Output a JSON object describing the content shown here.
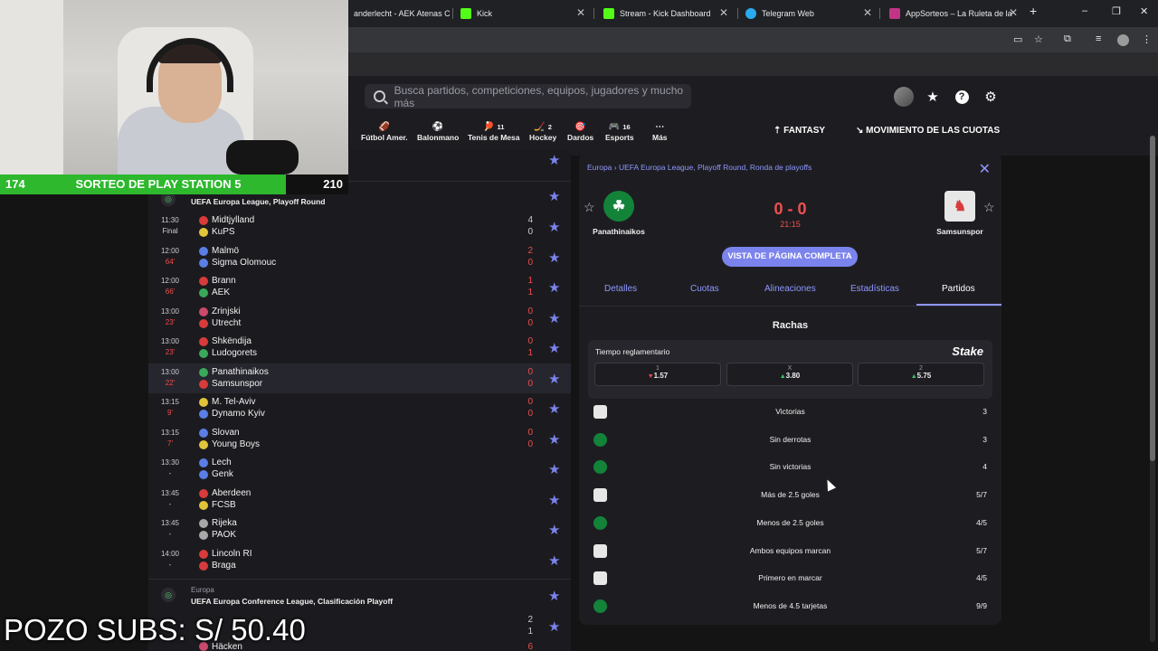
{
  "browser": {
    "tabs": [
      {
        "label": "anderlecht - AEK Atenas C",
        "favicon_color": "#202124"
      },
      {
        "label": "Kick",
        "favicon_color": "#53fc18"
      },
      {
        "label": "Stream - Kick Dashboard",
        "favicon_color": "#53fc18"
      },
      {
        "label": "Telegram Web",
        "favicon_color": "#2aabee"
      },
      {
        "label": "AppSorteos – La Ruleta de la S",
        "favicon_color": "#c13584"
      }
    ],
    "new_tab": "+",
    "window_controls": [
      "–",
      "❐",
      "✕"
    ]
  },
  "stream": {
    "left_count": "174",
    "banner": "SORTEO DE PLAY STATION 5",
    "right_count": "210",
    "pozo": "POZO SUBS: S/ 50.40"
  },
  "header": {
    "search_placeholder": "Busca partidos, competiciones, equipos, jugadores y mucho más",
    "sports": [
      {
        "label": "Fútbol Amer.",
        "count": "",
        "icon": "🏈"
      },
      {
        "label": "Balonmano",
        "count": "",
        "icon": "⚽"
      },
      {
        "label": "Tenis de Mesa",
        "count": "11",
        "icon": "🏓"
      },
      {
        "label": "Hockey",
        "count": "2",
        "icon": "🏒"
      },
      {
        "label": "Dardos",
        "count": "",
        "icon": "🎯"
      },
      {
        "label": "Esports",
        "count": "16",
        "icon": "🎮"
      },
      {
        "label": "Más",
        "count": "",
        "icon": "⋯"
      }
    ],
    "fantasy": "FANTASY",
    "movement": "MOVIMIENTO DE LAS CUOTAS"
  },
  "list": {
    "comp1": {
      "name": "UEFA Europa League, Playoff Round"
    },
    "matches": [
      {
        "time": "11:30",
        "status": "Final",
        "live": false,
        "home": "Midtjylland",
        "away": "KuPS",
        "hs": "4",
        "as": "0",
        "hc": "#d83b3b",
        "ac": "#e2c43a"
      },
      {
        "time": "12:00",
        "status": "64'",
        "live": true,
        "home": "Malmö",
        "away": "Sigma Olomouc",
        "hs": "2",
        "as": "0",
        "hc": "#5a7ee6",
        "ac": "#5a7ee6"
      },
      {
        "time": "12:00",
        "status": "66'",
        "live": true,
        "home": "Brann",
        "away": "AEK",
        "hs": "1",
        "as": "1",
        "hc": "#d83b3b",
        "ac": "#3aa85a"
      },
      {
        "time": "13:00",
        "status": "23'",
        "live": true,
        "home": "Zrinjski",
        "away": "Utrecht",
        "hs": "0",
        "as": "0",
        "hc": "#c94a6b",
        "ac": "#d83b3b"
      },
      {
        "time": "13:00",
        "status": "23'",
        "live": true,
        "home": "Shkëndija",
        "away": "Ludogorets",
        "hs": "0",
        "as": "1",
        "hc": "#d83b3b",
        "ac": "#3aa85a"
      },
      {
        "time": "13:00",
        "status": "22'",
        "live": true,
        "home": "Panathinaikos",
        "away": "Samsunspor",
        "hs": "0",
        "as": "0",
        "hc": "#3aa85a",
        "ac": "#d83b3b",
        "highlight": true
      },
      {
        "time": "13:15",
        "status": "9'",
        "live": true,
        "home": "M. Tel-Aviv",
        "away": "Dynamo Kyiv",
        "hs": "0",
        "as": "0",
        "hc": "#e2c43a",
        "ac": "#5a7ee6"
      },
      {
        "time": "13:15",
        "status": "7'",
        "live": true,
        "home": "Slovan",
        "away": "Young Boys",
        "hs": "0",
        "as": "0",
        "hc": "#5a7ee6",
        "ac": "#e2c43a"
      },
      {
        "time": "13:30",
        "status": "-",
        "live": false,
        "home": "Lech",
        "away": "Genk",
        "hs": "",
        "as": "",
        "hc": "#5a7ee6",
        "ac": "#5a7ee6"
      },
      {
        "time": "13:45",
        "status": "-",
        "live": false,
        "home": "Aberdeen",
        "away": "FCSB",
        "hs": "",
        "as": "",
        "hc": "#d83b3b",
        "ac": "#e2c43a"
      },
      {
        "time": "13:45",
        "status": "-",
        "live": false,
        "home": "Rijeka",
        "away": "PAOK",
        "hs": "",
        "as": "",
        "hc": "#a8a8a8",
        "ac": "#a8a8a8"
      },
      {
        "time": "14:00",
        "status": "-",
        "live": false,
        "home": "Lincoln RI",
        "away": "Braga",
        "hs": "",
        "as": "",
        "hc": "#d83b3b",
        "ac": "#d83b3b"
      }
    ],
    "comp2": {
      "country": "Europa",
      "name": "UEFA Europa Conference League, Clasificación Playoff"
    },
    "partial": [
      {
        "team": "Häcken",
        "score": "6"
      }
    ],
    "partial_scores": [
      "2",
      "1"
    ]
  },
  "panel": {
    "breadcrumb": {
      "region": "Europa",
      "competition": "UEFA Europa League, Playoff Round, Ronda de playoffs"
    },
    "home": "Panathinaikos",
    "away": "Samsunspor",
    "score": "0 - 0",
    "time": "21:15",
    "full_page_button": "VISTA DE PÁGINA COMPLETA",
    "tabs": [
      "Detalles",
      "Cuotas",
      "Alineaciones",
      "Estadísticas",
      "Partidos"
    ],
    "active_tab": "Partidos",
    "section_title": "Rachas",
    "odds": {
      "label": "Tiempo reglamentario",
      "brand": "Stake",
      "items": [
        {
          "key": "1",
          "value": "1.57",
          "dir": "down"
        },
        {
          "key": "X",
          "value": "3.80",
          "dir": "up"
        },
        {
          "key": "2",
          "value": "5.75",
          "dir": "up"
        }
      ]
    },
    "streaks": [
      {
        "team": "away",
        "label": "Victorias",
        "value": "3"
      },
      {
        "team": "home",
        "label": "Sin derrotas",
        "value": "3"
      },
      {
        "team": "home",
        "label": "Sin victorias",
        "value": "4"
      },
      {
        "team": "away",
        "label": "Más de 2.5 goles",
        "value": "5/7"
      },
      {
        "team": "home",
        "label": "Menos de 2.5 goles",
        "value": "4/5"
      },
      {
        "team": "away",
        "label": "Ambos equipos marcan",
        "value": "5/7"
      },
      {
        "team": "away",
        "label": "Primero en marcar",
        "value": "4/5"
      },
      {
        "team": "home",
        "label": "Menos de 4.5 tarjetas",
        "value": "9/9"
      }
    ]
  }
}
